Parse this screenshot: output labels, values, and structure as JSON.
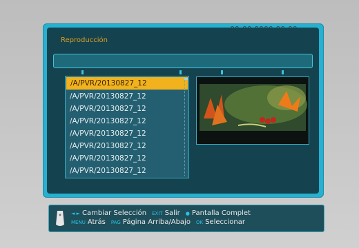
{
  "header": {
    "title": "Reproducción",
    "clock": "00-00  0000 00:00"
  },
  "files": [
    "/A/PVR/20130827_12",
    "/A/PVR/20130827_12",
    "/A/PVR/20130827_12",
    "/A/PVR/20130827_12",
    "/A/PVR/20130827_12",
    "/A/PVR/20130827_12",
    "/A/PVR/20130827_12",
    "/A/PVR/20130827_12"
  ],
  "selected_index": 0,
  "footer": {
    "row1": [
      {
        "key": "◄ ►",
        "label": "Cambiar Selección"
      },
      {
        "key": "EXIT",
        "label": "Salir"
      },
      {
        "key": "●",
        "label": "Pantalla Complet"
      }
    ],
    "row2": [
      {
        "key": "MENU",
        "label": "Atrás"
      },
      {
        "key": "PAG",
        "label": "Página Arriba/Abajo"
      },
      {
        "key": "OK",
        "label": "Seleccionar"
      }
    ]
  },
  "colors": {
    "accent": "#f1b21d",
    "frame": "#27b0cf",
    "panel": "#14434f"
  },
  "icons": {
    "remote": "remote-control-icon"
  }
}
